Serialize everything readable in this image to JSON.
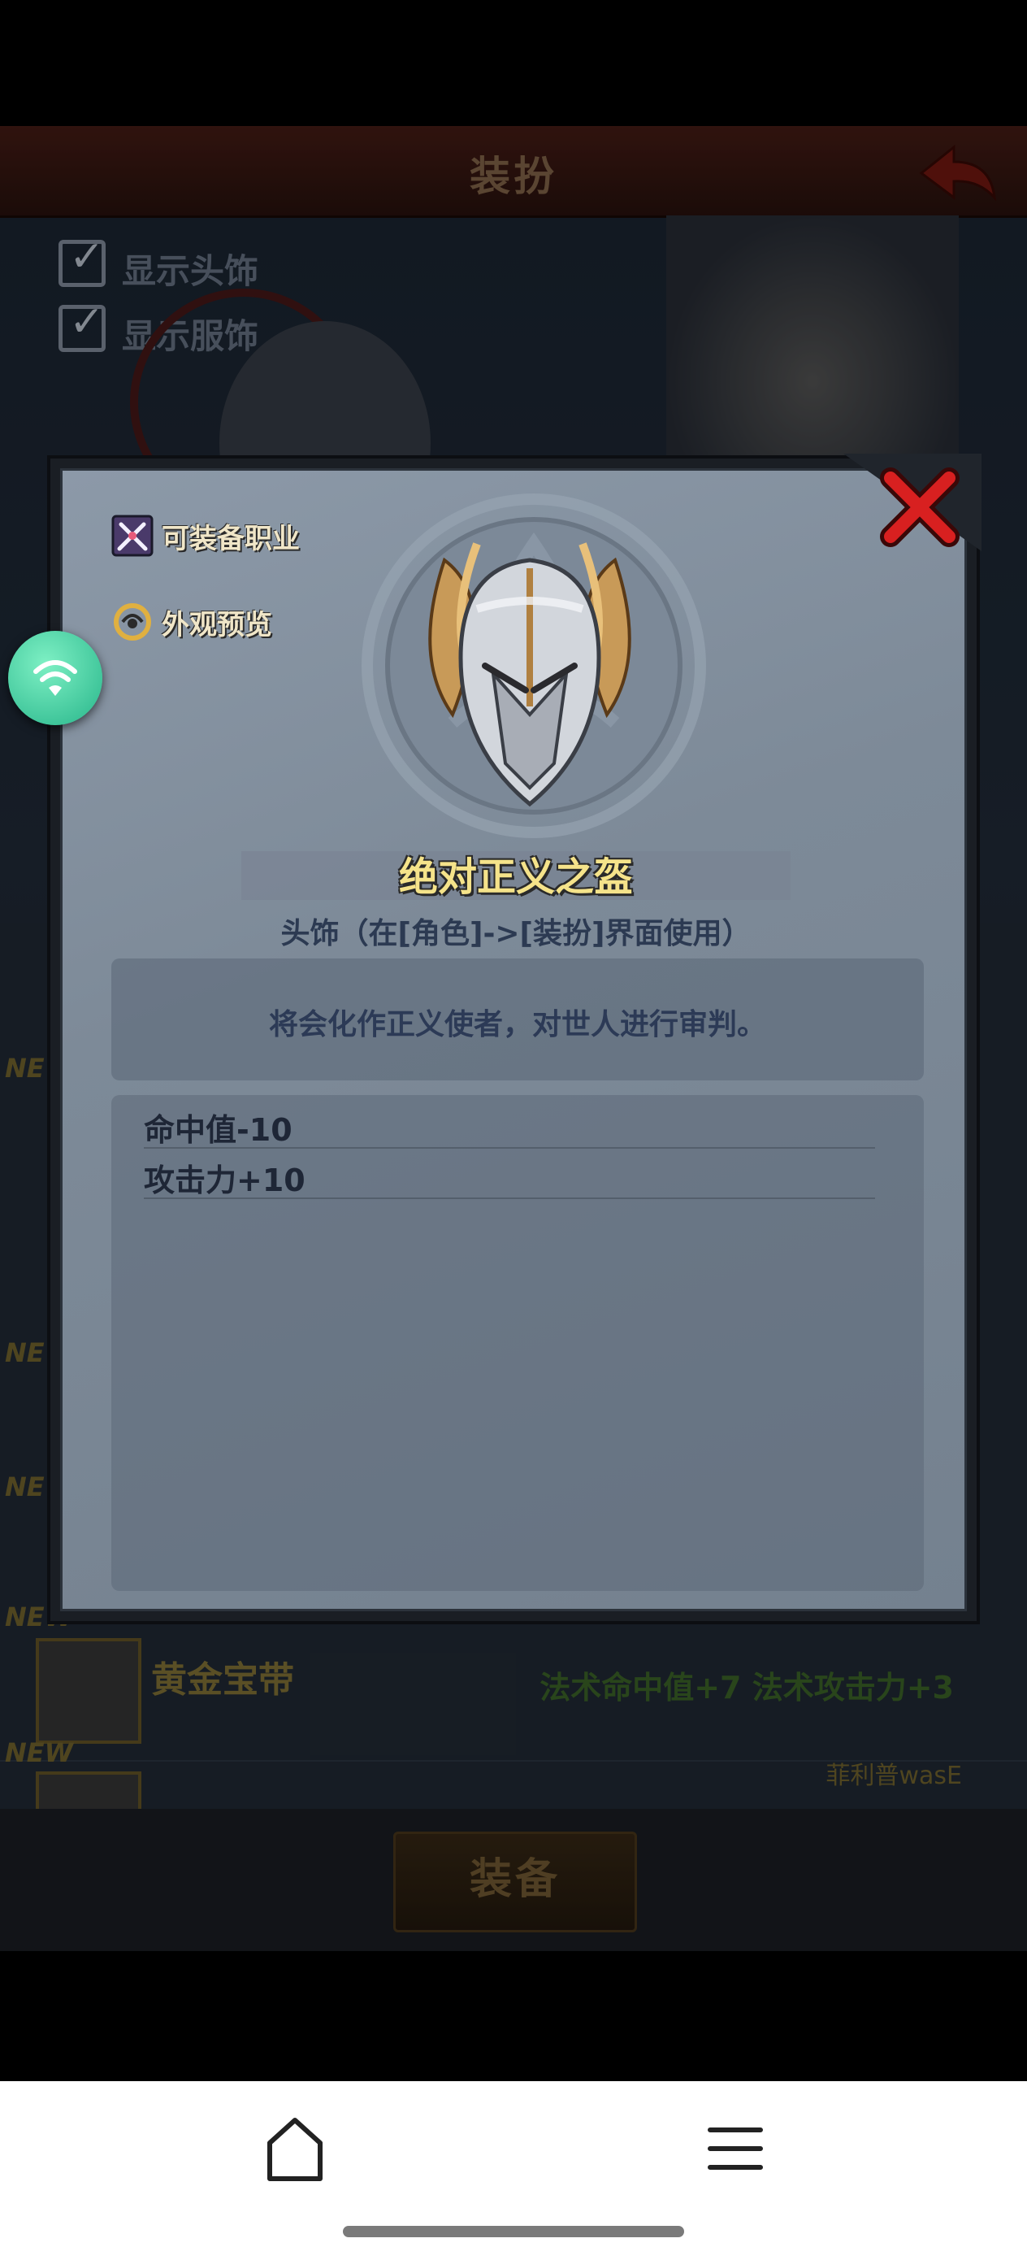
{
  "header": {
    "title": "装扮"
  },
  "toggles": [
    {
      "label": "显示头饰",
      "checked": true
    },
    {
      "label": "显示服饰",
      "checked": true
    }
  ],
  "background_list": {
    "new_tag": "NEW",
    "rows": [
      {
        "name": "黄金宝带",
        "stats": "法术命中值+7  法术攻击力+3"
      },
      {
        "name": "",
        "owner": "菲利普wasE"
      }
    ],
    "equip_button": "装备"
  },
  "modal": {
    "links": [
      {
        "label": "可装备职业",
        "icon": "sword-class-icon"
      },
      {
        "label": "外观预览",
        "icon": "preview-icon"
      }
    ],
    "item": {
      "name": "绝对正义之盔",
      "subtitle": "头饰（在[角色]->[装扮]界面使用）",
      "description": "将会化作正义使者，对世人进行审判。",
      "stats": [
        "命中值-10",
        "攻击力+10"
      ],
      "icon": "winged-helmet-icon"
    },
    "close_icon": "close-x-icon"
  },
  "overlay": {
    "icon": "wifi-icon"
  },
  "navbar": {
    "home_icon": "home-icon",
    "menu_icon": "menu-icon"
  }
}
